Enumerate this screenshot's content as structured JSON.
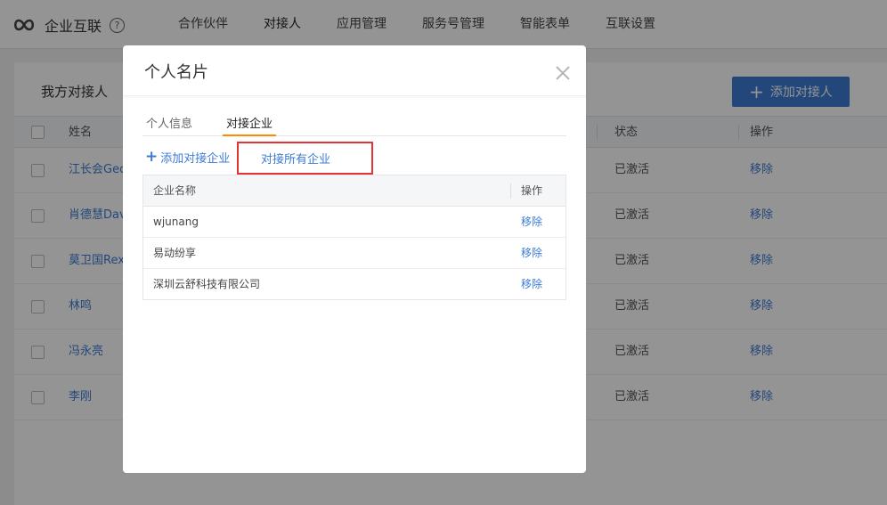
{
  "header": {
    "brand": "企业互联",
    "help": "?",
    "nav": [
      {
        "label": "合作伙伴"
      },
      {
        "label": "对接人",
        "active": true
      },
      {
        "label": "应用管理"
      },
      {
        "label": "服务号管理"
      },
      {
        "label": "智能表单"
      },
      {
        "label": "互联设置"
      }
    ]
  },
  "main": {
    "title": "我方对接人",
    "add_button": "添加对接人",
    "columns": {
      "name": "姓名",
      "status": "状态",
      "action": "操作"
    },
    "rows": [
      {
        "name": "江长会Geo",
        "status": "已激活",
        "action": "移除"
      },
      {
        "name": "肖德慧Dav",
        "status": "已激活",
        "action": "移除"
      },
      {
        "name": "莫卫国Rex",
        "status": "已激活",
        "action": "移除"
      },
      {
        "name": "林鸣",
        "status": "已激活",
        "action": "移除"
      },
      {
        "name": "冯永亮",
        "status": "已激活",
        "action": "移除"
      },
      {
        "name": "李刚",
        "status": "已激活",
        "action": "移除"
      }
    ]
  },
  "modal": {
    "title": "个人名片",
    "tabs": [
      {
        "label": "个人信息"
      },
      {
        "label": "对接企业",
        "active": true
      }
    ],
    "add_company": "添加对接企业",
    "all_companies": "对接所有企业",
    "table": {
      "col_name": "企业名称",
      "col_action": "操作",
      "rows": [
        {
          "name": "wjunang",
          "action": "移除"
        },
        {
          "name": "易动纷享",
          "action": "移除"
        },
        {
          "name": "深圳云舒科技有限公司",
          "action": "移除"
        }
      ]
    }
  },
  "colors": {
    "accent": "#ff8a00",
    "link": "#3d7bd3",
    "primary_button": "#3d7bd3",
    "highlight": "#e23434"
  }
}
